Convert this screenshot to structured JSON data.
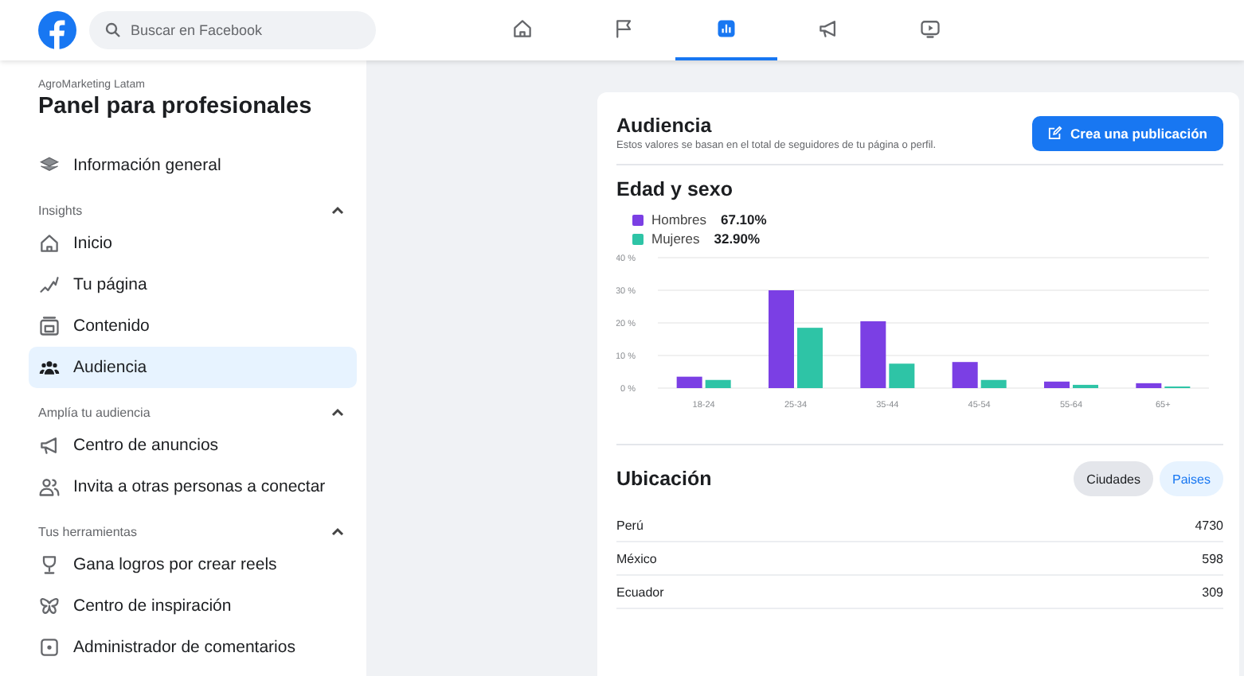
{
  "search": {
    "placeholder": "Buscar en Facebook"
  },
  "nav_tabs": [
    {
      "kind": "home",
      "selected": false
    },
    {
      "kind": "flag",
      "selected": false
    },
    {
      "kind": "insights",
      "selected": true
    },
    {
      "kind": "megaphone",
      "selected": false
    },
    {
      "kind": "video",
      "selected": false
    }
  ],
  "sidebar": {
    "account": "AgroMarketing Latam",
    "title": "Panel para profesionales",
    "top_items": [
      {
        "kind": "layers",
        "label": "Información general",
        "selected": false
      }
    ],
    "sections": [
      {
        "title": "Insights",
        "expanded": true,
        "items": [
          {
            "kind": "home",
            "label": "Inicio",
            "selected": false
          },
          {
            "kind": "trend",
            "label": "Tu página",
            "selected": false
          },
          {
            "kind": "content",
            "label": "Contenido",
            "selected": false
          },
          {
            "kind": "people",
            "label": "Audiencia",
            "selected": true
          }
        ]
      },
      {
        "title": "Amplía tu audiencia",
        "expanded": true,
        "items": [
          {
            "kind": "megaphone",
            "label": "Centro de anuncios",
            "selected": false
          },
          {
            "kind": "invite",
            "label": "Invita a otras personas a conectar",
            "selected": false
          }
        ]
      },
      {
        "title": "Tus herramientas",
        "expanded": true,
        "items": [
          {
            "kind": "trophy",
            "label": "Gana logros por crear reels",
            "selected": false
          },
          {
            "kind": "butterfly",
            "label": "Centro de inspiración",
            "selected": false
          },
          {
            "kind": "comment",
            "label": "Administrador de comentarios",
            "selected": false
          }
        ]
      }
    ]
  },
  "audience": {
    "title": "Audiencia",
    "subtitle": "Estos valores se basan en el total de seguidores de tu página o perfil.",
    "create_button": "Crea una publicación"
  },
  "age_gender": {
    "title": "Edad y sexo",
    "legend_values": [
      "67.10%",
      "32.90%"
    ],
    "chart_data": {
      "type": "bar",
      "grid": true,
      "categories": [
        "18-24",
        "25-34",
        "35-44",
        "45-54",
        "55-64",
        "65+"
      ],
      "series": [
        {
          "name": "Hombres",
          "color": "#7b3fe4",
          "values": [
            3.5,
            30,
            20.5,
            8,
            2,
            1.5
          ]
        },
        {
          "name": "Mujeres",
          "color": "#2ec4a6",
          "values": [
            2.5,
            18.5,
            7.5,
            2.5,
            1,
            0.5
          ]
        }
      ],
      "ylim": [
        0,
        40
      ],
      "yticks": [
        {
          "value": 0,
          "label": "0 %"
        },
        {
          "value": 10,
          "label": "10 %"
        },
        {
          "value": 20,
          "label": "20 %"
        },
        {
          "value": 30,
          "label": "30 %"
        },
        {
          "value": 40,
          "label": "40 %"
        }
      ]
    }
  },
  "location": {
    "title": "Ubicación",
    "toggles": [
      {
        "label": "Ciudades",
        "selected": false
      },
      {
        "label": "Paises",
        "selected": true
      }
    ],
    "rows": [
      {
        "name": "Perú",
        "count": "4730"
      },
      {
        "name": "México",
        "count": "598"
      },
      {
        "name": "Ecuador",
        "count": "309"
      }
    ]
  }
}
